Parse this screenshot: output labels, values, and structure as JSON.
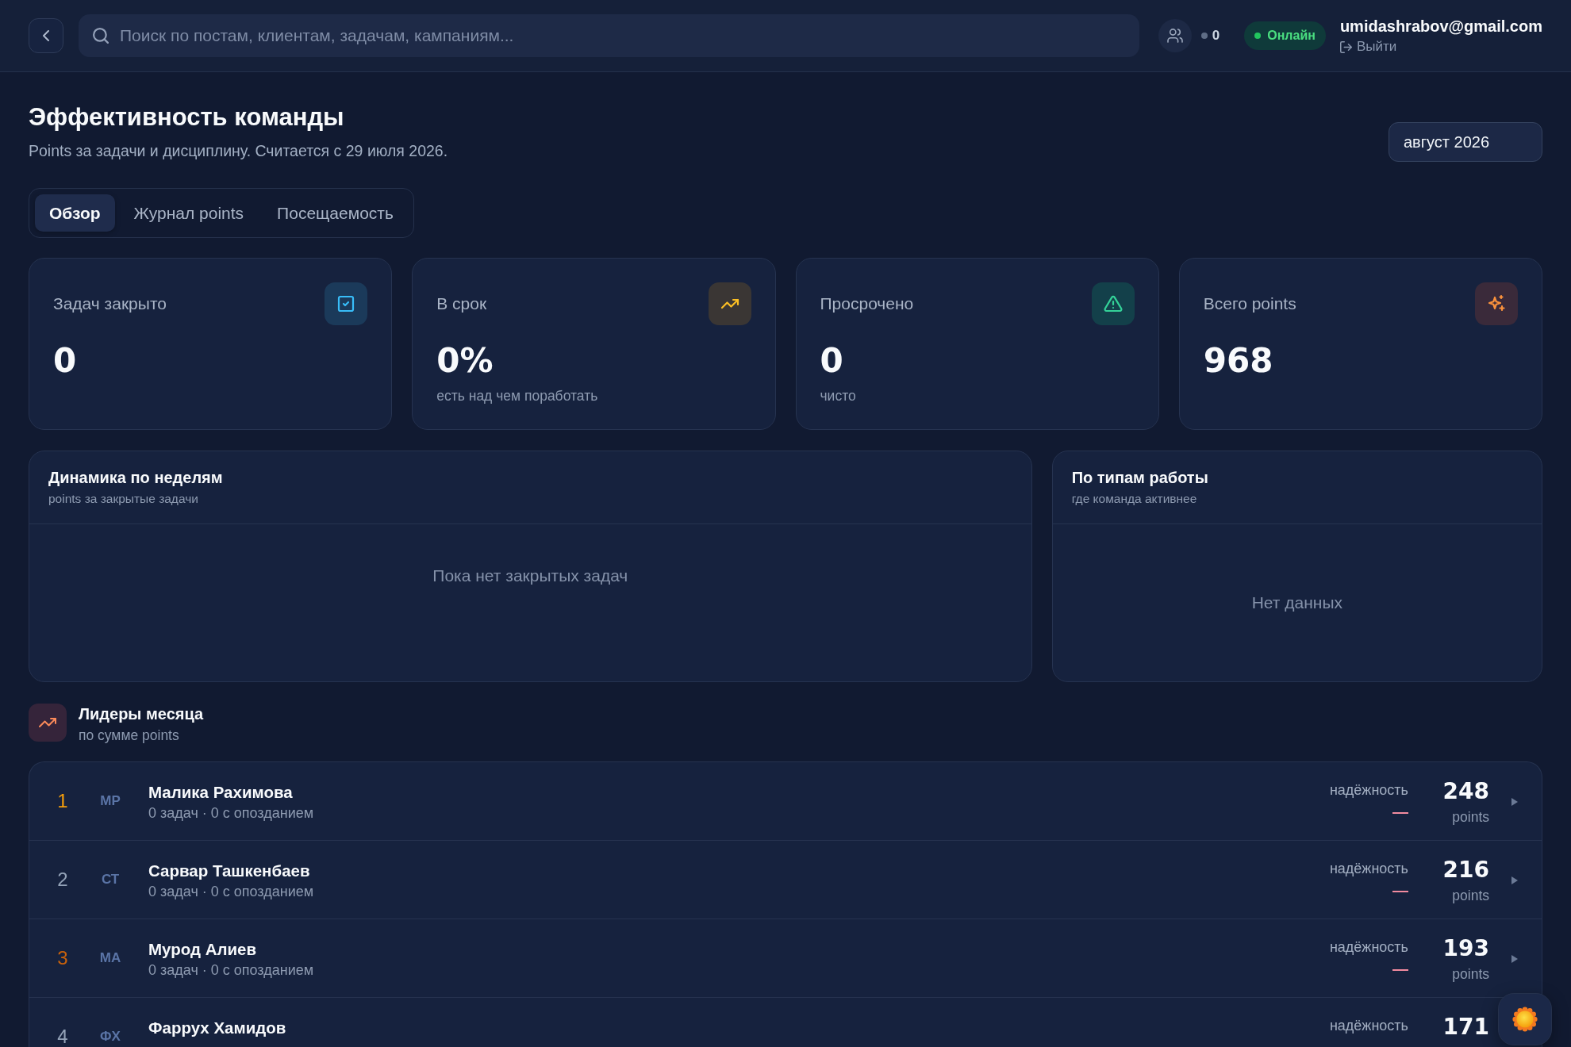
{
  "topbar": {
    "search": {
      "placeholder": "Поиск по постам, клиентам, задачам, кампаниям..."
    },
    "online_count": "0",
    "status": {
      "label": "Онлайн",
      "online": true
    },
    "user": {
      "email": "umidashrabov@gmail.com",
      "logout": "Выйти"
    }
  },
  "header": {
    "title": "Эффективность команды",
    "subtitle": "Points за задачи и дисциплину. Считается с 29 июля 2026.",
    "month": "август 2026"
  },
  "tabs": [
    {
      "label": "Обзор",
      "selected": true
    },
    {
      "label": "Журнал points",
      "selected": false
    },
    {
      "label": "Посещаемость",
      "selected": false
    }
  ],
  "stats": [
    {
      "label": "Задач закрыто",
      "value": "0"
    },
    {
      "label": "В срок",
      "value": "0%",
      "note": "есть над чем поработать"
    },
    {
      "label": "Просрочено",
      "value": "0",
      "note": "чисто"
    },
    {
      "label": "Всего points",
      "value": "968"
    }
  ],
  "panels": [
    {
      "title": "Динамика по неделям",
      "subtitle": "points за закрытые задачи",
      "empty_text": "Пока нет закрытых задач"
    },
    {
      "title": "По типам работы",
      "subtitle": "где команда активнее",
      "empty_text": "Нет данных"
    }
  ],
  "leaders": {
    "title": "Лидеры месяца",
    "subtitle": "по сумме points",
    "rows": [
      {
        "rank": "1",
        "color": "#f59e0b",
        "initials": "МР",
        "name": "Малика Рахимова",
        "tasks": "0 задач · 0 с опозданием",
        "reliability_label": "надёжность",
        "reliability": "—",
        "points": "248",
        "points_label": "points",
        "expanded": false
      },
      {
        "rank": "2",
        "color": "#94a3b8",
        "initials": "СТ",
        "name": "Сарвар Ташкенбаев",
        "tasks": "0 задач · 0 с опозданием",
        "reliability_label": "надёжность",
        "reliability": "—",
        "points": "216",
        "points_label": "points",
        "expanded": false
      },
      {
        "rank": "3",
        "color": "#c9620c",
        "initials": "МА",
        "name": "Мурод Алиев",
        "tasks": "0 задач · 0 с опозданием",
        "reliability_label": "надёжность",
        "reliability": "—",
        "points": "193",
        "points_label": "points",
        "expanded": false
      },
      {
        "rank": "4",
        "color": "#94a3b8",
        "initials": "ФХ",
        "name": "Фаррух Хамидов",
        "reliability_label": "надёжность",
        "points": "171"
      }
    ]
  }
}
